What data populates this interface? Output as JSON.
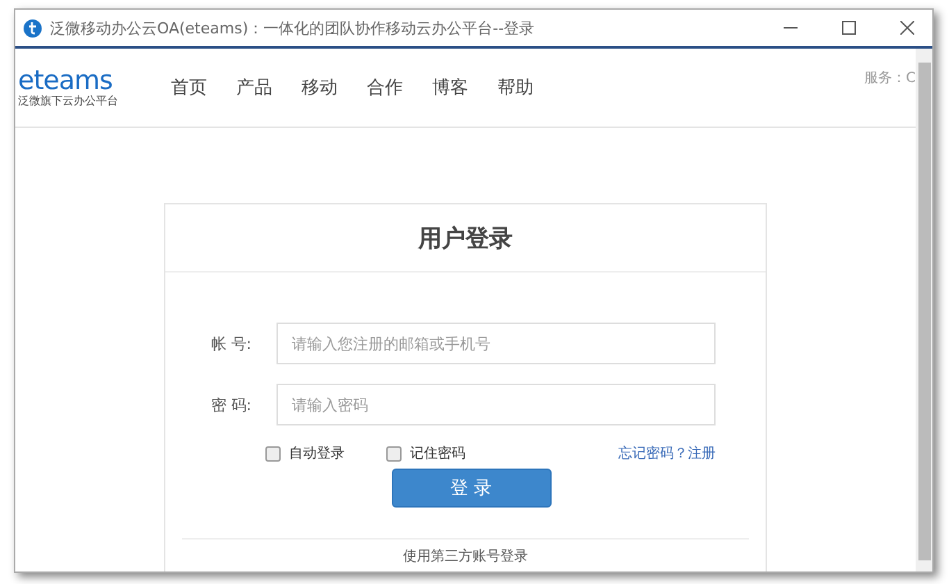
{
  "window": {
    "title": "泛微移动办公云OA(eteams)：一体化的团队协作移动云办公平台--登录"
  },
  "header": {
    "logo": "eteams",
    "logo_subtitle": "泛微旗下云办公平台",
    "service": "服务：C",
    "nav": [
      {
        "label": "首页"
      },
      {
        "label": "产品"
      },
      {
        "label": "移动"
      },
      {
        "label": "合作"
      },
      {
        "label": "博客"
      },
      {
        "label": "帮助"
      }
    ]
  },
  "login": {
    "title": "用户登录",
    "fields": [
      {
        "label": "帐 号:",
        "placeholder": "请输入您注册的邮箱或手机号"
      },
      {
        "label": "密 码:",
        "placeholder": "请输入密码"
      }
    ],
    "options": [
      {
        "label": "自动登录",
        "checked": false
      },
      {
        "label": "记住密码",
        "checked": false
      }
    ],
    "forgot_link": "忘记密码？注册",
    "submit": "登 录",
    "third_party": "使用第三方账号登录"
  }
}
